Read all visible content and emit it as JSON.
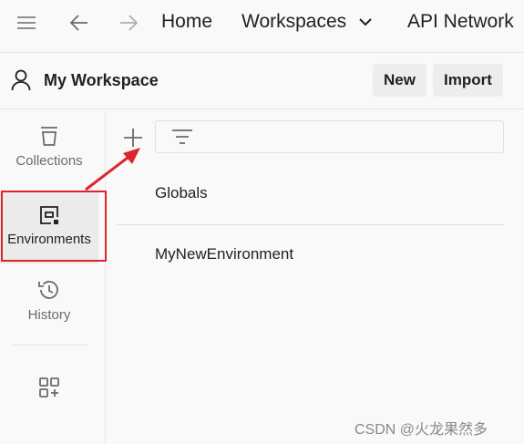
{
  "topbar": {
    "menu_icon": "hamburger-icon",
    "back_icon": "arrow-left-icon",
    "forward_icon": "arrow-right-icon",
    "home": "Home",
    "workspaces": "Workspaces",
    "api_network": "API Network"
  },
  "workspace": {
    "title": "My Workspace",
    "new_label": "New",
    "import_label": "Import"
  },
  "rail": {
    "items": [
      {
        "label": "Collections",
        "icon": "trash-can-icon"
      },
      {
        "label": "Environments",
        "icon": "environment-icon",
        "active": true
      },
      {
        "label": "History",
        "icon": "history-icon"
      }
    ],
    "more_icon": "apps-add-icon"
  },
  "environments": {
    "items": [
      "Globals",
      "MyNewEnvironment"
    ]
  },
  "annotation": {
    "highlight_color": "#e0242b"
  },
  "watermark": "CSDN @火龙果然多"
}
